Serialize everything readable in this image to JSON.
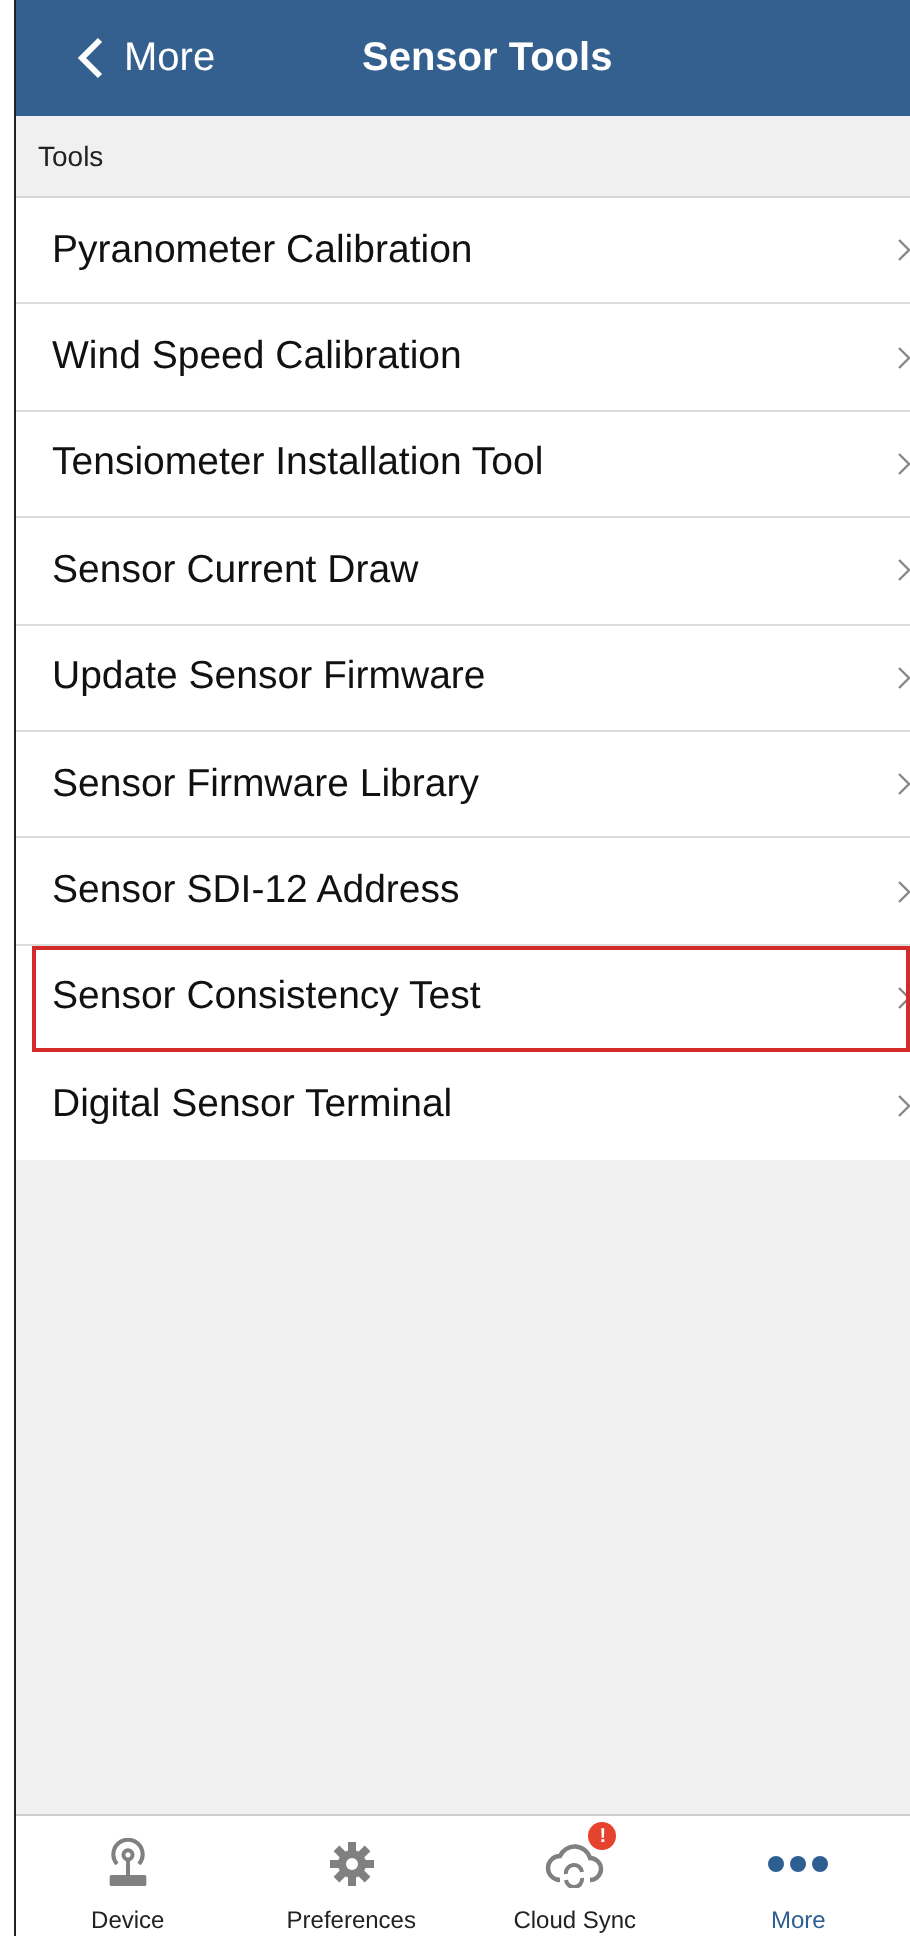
{
  "header": {
    "back_label": "More",
    "title": "Sensor Tools"
  },
  "section": {
    "title": "Tools"
  },
  "items": [
    {
      "label": "Pyranometer Calibration",
      "highlighted": false
    },
    {
      "label": "Wind Speed Calibration",
      "highlighted": false
    },
    {
      "label": "Tensiometer Installation Tool",
      "highlighted": false
    },
    {
      "label": "Sensor Current Draw",
      "highlighted": false
    },
    {
      "label": "Update Sensor Firmware",
      "highlighted": false
    },
    {
      "label": "Sensor Firmware Library",
      "highlighted": false
    },
    {
      "label": "Sensor SDI-12 Address",
      "highlighted": false
    },
    {
      "label": "Sensor Consistency Test",
      "highlighted": true
    },
    {
      "label": "Digital Sensor Terminal",
      "highlighted": false
    }
  ],
  "tab_bar": [
    {
      "kind": "device",
      "label": "Device",
      "selected": false
    },
    {
      "kind": "preferences",
      "label": "Preferences",
      "selected": false
    },
    {
      "kind": "cloud",
      "label": "Cloud Sync",
      "selected": false,
      "badge": "!"
    },
    {
      "kind": "more",
      "label": "More",
      "selected": true
    }
  ]
}
